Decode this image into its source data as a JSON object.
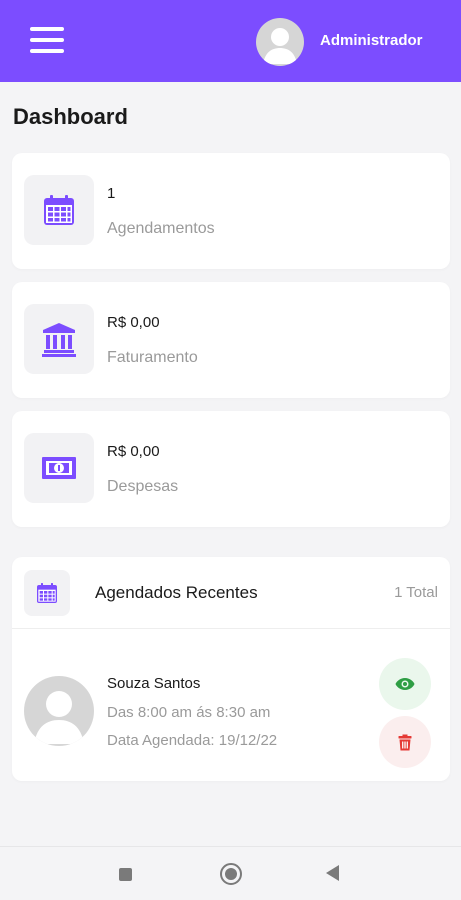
{
  "header": {
    "user_name": "Administrador",
    "accent_color": "#7c4dff"
  },
  "page": {
    "title": "Dashboard"
  },
  "stats": [
    {
      "icon": "calendar-icon",
      "value": "1",
      "label": "Agendamentos"
    },
    {
      "icon": "bank-icon",
      "value": "R$ 0,00",
      "label": "Faturamento"
    },
    {
      "icon": "money-bill-icon",
      "value": "R$ 0,00",
      "label": "Despesas"
    }
  ],
  "recent": {
    "icon": "calendar-icon",
    "title": "Agendados Recentes",
    "total": "1 Total",
    "appointments": [
      {
        "name": "Souza Santos",
        "time": "Das 8:00 am ás 8:30 am",
        "date": "Data Agendada: 19/12/22",
        "view_icon": "eye-icon",
        "delete_icon": "trash-icon"
      }
    ]
  },
  "navigation": {
    "buttons": [
      "recent-apps-icon",
      "home-icon",
      "back-icon"
    ]
  }
}
